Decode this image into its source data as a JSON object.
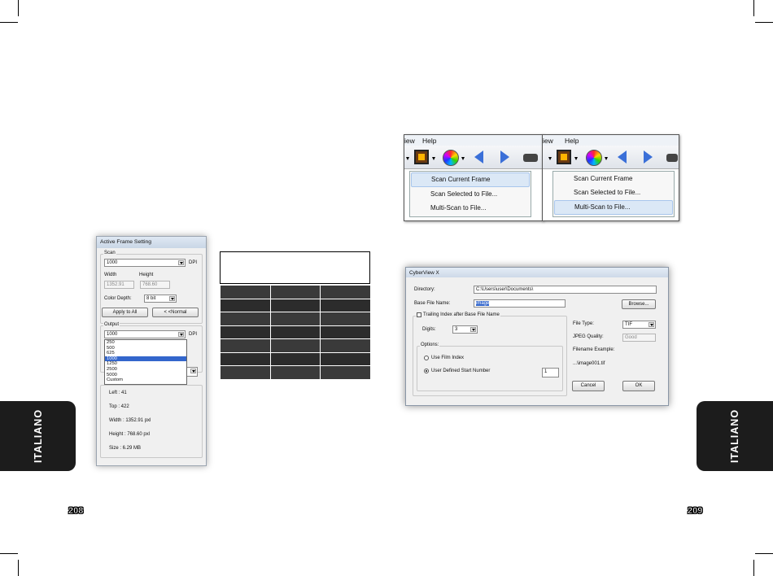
{
  "left_page": {
    "side_tab": "ITALIANO",
    "page_number": "208",
    "active_frame_dialog": {
      "title": "Active Frame Setting",
      "scan_group": "Scan",
      "scan_dpi_value": "1000",
      "dpi_unit": "DPI",
      "width_label": "Width",
      "height_label": "Height",
      "width_value": "1352.91",
      "height_value": "768.60",
      "color_depth_label": "Color Depth:",
      "color_depth_value": "8 bit",
      "apply_all_label": "Apply to All",
      "normal_label": "< <Normal",
      "output_group": "Output",
      "output_dpi_value": "1000",
      "output_dpi_unit": "DPI",
      "dpi_options": [
        "250",
        "500",
        "625",
        "1000",
        "1250",
        "2500",
        "5000",
        "Custom"
      ],
      "dpi_selected": "1000",
      "info_left": "Left : 41",
      "info_top": "Top : 422",
      "info_width": "Width : 1352.91 pxl",
      "info_height": "Height : 768.60 pxl",
      "info_size": "Size : 6.29 MB"
    }
  },
  "right_page": {
    "side_tab": "ITALIANO",
    "page_number": "209",
    "menu_shot_1": {
      "menu_view": "iew",
      "menu_help": "Help",
      "items": [
        "Scan Current Frame",
        "Scan Selected to File...",
        "Multi-Scan to File..."
      ],
      "highlighted_index": 0
    },
    "menu_shot_2": {
      "menu_view": "iew",
      "menu_help": "Help",
      "items": [
        "Scan Current Frame",
        "Scan Selected to File...",
        "Multi-Scan to File..."
      ],
      "highlighted_index": 2
    },
    "cyberview_dialog": {
      "title": "CyberView X",
      "directory_label": "Directory:",
      "directory_value": "C:\\Users\\user\\Documents\\",
      "base_file_label": "Base File Name:",
      "base_file_value": "image",
      "browse_label": "Browse...",
      "trailing_index_label": "Trailing Index after Base File Name",
      "digits_label": "Digits:",
      "digits_value": "3",
      "options_label": "Options:",
      "use_film_index_label": "Use Film Index",
      "user_defined_label": "User Defined Start Number",
      "start_number_value": "1",
      "file_type_label": "File Type:",
      "file_type_value": "TIF",
      "jpeg_quality_label": "JPEG Quality:",
      "jpeg_quality_value": "Good",
      "filename_example_label": "Filename Example:",
      "filename_example_value": "...\\image001.tif",
      "cancel_label": "Cancel",
      "ok_label": "OK"
    }
  }
}
